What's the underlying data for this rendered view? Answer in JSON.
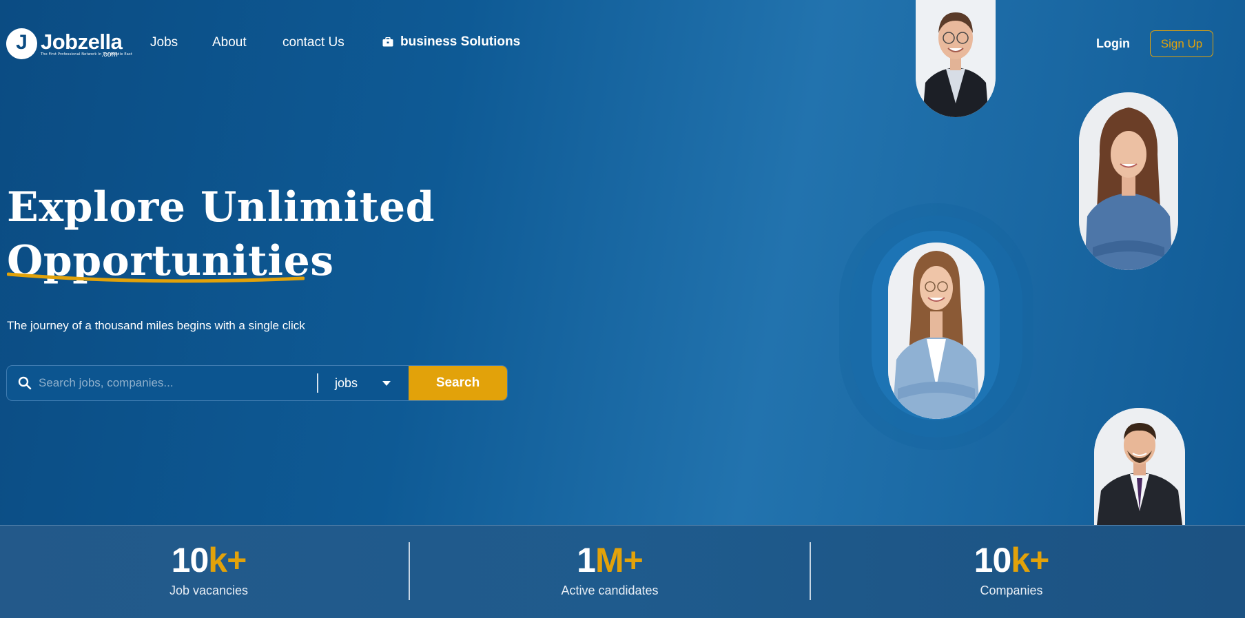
{
  "brand": {
    "name": "Jobzella",
    "tagline": "The First Professional Network In The Middle East",
    "domain": ".com"
  },
  "nav": {
    "links": [
      {
        "label": "Jobs"
      },
      {
        "label": "About"
      },
      {
        "label": "contact Us"
      },
      {
        "label": "business Solutions",
        "icon": "briefcase-icon"
      }
    ],
    "login": "Login",
    "signup": "Sign Up"
  },
  "hero": {
    "title_line1": "Explore Unlimited",
    "title_line2": "Opportunities",
    "subtitle": "The journey of a thousand miles begins with a single click"
  },
  "search": {
    "placeholder": "Search jobs, companies...",
    "category": "jobs",
    "button": "Search"
  },
  "stats": [
    {
      "number": "10",
      "suffix": "k+",
      "label": "Job vacancies"
    },
    {
      "number": "1",
      "suffix": "M+",
      "label": "Active candidates"
    },
    {
      "number": "10",
      "suffix": "k+",
      "label": "Companies"
    }
  ],
  "colors": {
    "accent": "#e2a20a",
    "hero": "#0b4c83"
  }
}
